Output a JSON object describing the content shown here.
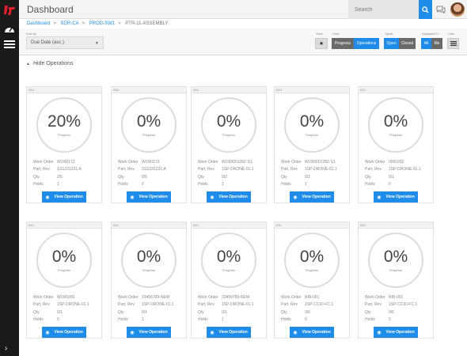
{
  "header": {
    "title": "Dashboard",
    "search_placeholder": "Search"
  },
  "breadcrumb": [
    "Dashboard",
    "SDR-CA",
    "PROD-SW1",
    "PTR-11-ASSEMBLY"
  ],
  "toolbar": {
    "sort_label": "Sort by",
    "sort_value": "Due Date (asc.)",
    "save_label": "Save",
    "view_label": "View",
    "view_options": [
      "Progress",
      "Operations"
    ],
    "view_selected": "Operations",
    "types_label": "Types",
    "type_options": [
      "Open",
      "Closed"
    ],
    "type_selected": "Open",
    "assigned_label": "Assigned To",
    "assigned_options": [
      "All",
      "Me"
    ],
    "assigned_selected": "All",
    "lists_label": "Lists"
  },
  "toggle_label": "Hide Operations",
  "labels": {
    "progress": "Progress",
    "work_order": "Work Order",
    "part_rev": "Part, Rev",
    "qty": "Qty",
    "holds": "Holds",
    "view_button": "View Operation"
  },
  "cards": [
    {
      "op": "010",
      "pct": "20%",
      "progress": 0.2,
      "work_order": "WO00172",
      "part_rev": "SS1231231.A",
      "qty": "2/5",
      "holds": "1"
    },
    {
      "op": "030",
      "pct": "0%",
      "progress": 0,
      "work_order": "WO00172",
      "part_rev": "SS1231231.A",
      "qty": "0/5",
      "holds": "2"
    },
    {
      "op": "010",
      "pct": "0%",
      "progress": 0,
      "work_order": "WO00001282-S1",
      "part_rev": "1SP-DRONE-01.1",
      "qty": "0/2",
      "holds": "1"
    },
    {
      "op": "010",
      "pct": "0%",
      "progress": 0,
      "work_order": "WO00001282-S1",
      "part_rev": "1SP-DRONE-01.1",
      "qty": "0/2",
      "holds": "1"
    },
    {
      "op": "010",
      "pct": "0%",
      "progress": 0,
      "work_order": "0000282",
      "part_rev": "1SP-DRONE-01.1",
      "qty": "0/1",
      "holds": "0"
    },
    {
      "op": "010",
      "pct": "0%",
      "progress": 0,
      "work_order": "WO00282",
      "part_rev": "1SP-DRONE-01.1",
      "qty": "0/1",
      "holds": "0"
    },
    {
      "op": "010",
      "pct": "0%",
      "progress": 0,
      "work_order": "23456789-NEW",
      "part_rev": "1SP-DRONE-01.1",
      "qty": "0/1",
      "holds": "1"
    },
    {
      "op": "010",
      "pct": "0%",
      "progress": 0,
      "work_order": "23456789-NEW",
      "part_rev": "1SP-DRONE-01.1",
      "qty": "0/1",
      "holds": "1"
    },
    {
      "op": "011",
      "pct": "0%",
      "progress": 0,
      "work_order": "RIB-001",
      "part_rev": "1SP-CCIO-FC.1",
      "qty": "0/6",
      "holds": "0"
    },
    {
      "op": "020",
      "pct": "0%",
      "progress": 0,
      "work_order": "RIB-001",
      "part_rev": "1SP-CCIO-FC.1",
      "qty": "0/6",
      "holds": "0"
    }
  ],
  "colors": {
    "accent": "#1e8ce8",
    "sidebar": "#1a1a1a",
    "brand": "#e8202a"
  }
}
